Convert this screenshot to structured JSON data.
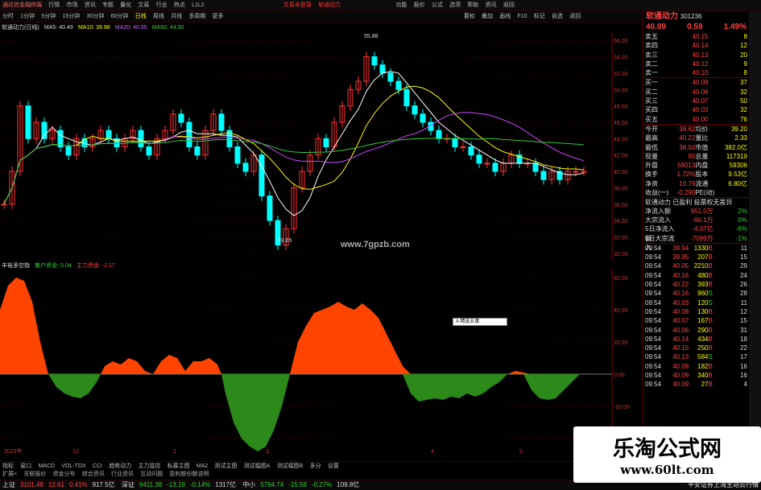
{
  "titlebar": {
    "app": "通达信金融终端",
    "menus": [
      "行情",
      "市场",
      "资讯",
      "专题",
      "量化",
      "文易",
      "行业",
      "热点",
      "L1L2"
    ],
    "mode": "文易未登录",
    "stock_mode": "软通动力",
    "right": [
      "功能",
      "报价",
      "公式",
      "选项",
      "帮助",
      "资讯",
      "返回"
    ]
  },
  "periodbar": {
    "items": [
      "分时",
      "1分钟",
      "5分钟",
      "15分钟",
      "30分钟",
      "60分钟",
      "日线",
      "周线",
      "月线",
      "多周期",
      "更多"
    ],
    "active": "日线",
    "right": [
      "置权",
      "叠加",
      "画线",
      "F10",
      "标记",
      "自选",
      "返回"
    ]
  },
  "kinfo": {
    "name": "软通动力(日线)",
    "ma5": "MA5: 40.49",
    "ma10": "MA10: 39.98",
    "ma20": "MA20: 40.95",
    "ma60": "MA60: 44.90"
  },
  "chart_labels": {
    "high": "55.88",
    "low": "28.65",
    "watermark": "www.7gpzb.com"
  },
  "subinfo": {
    "name": "丰裕多空指",
    "dark": "散户资金: 0.04",
    "red": "主力资金: -2.17"
  },
  "tooltip": "A 精选五度 ",
  "tabs": [
    "指标",
    "窗口",
    "MACD",
    "VOL-TDX",
    "CCI",
    "趋势动力",
    "主力监控",
    "私募主图",
    "MA2",
    "测试主图",
    "测试幅图A",
    "测试幅图B",
    "多分",
    "设置"
  ],
  "secbar": [
    "扩展<",
    "关联报价",
    "资金分布",
    "综合资讯",
    "行业资讯",
    "互动问题",
    "盈利额份额说明"
  ],
  "status": [
    {
      "label": "上证",
      "value": "3101.48",
      "chg": "12.61",
      "pct": "0.41%",
      "amt": "917.5亿"
    },
    {
      "label": "深证",
      "value": "9411.38",
      "chg": "-13.19",
      "pct": "-0.14%",
      "amt": "1317亿"
    },
    {
      "label": "中小",
      "value": "5794.74",
      "chg": "-15.58",
      "pct": "-0.27%",
      "amt": "109.8亿"
    }
  ],
  "status_right": "平安证券上海主站云行情",
  "quote": {
    "name": "软通动力",
    "code": "301236",
    "price": "40.09",
    "chg": "0.59",
    "pct": "1.49%",
    "asks": [
      [
        "卖五",
        "40.15",
        "8"
      ],
      [
        "卖四",
        "40.14",
        "12"
      ],
      [
        "卖三",
        "40.13",
        "20"
      ],
      [
        "卖二",
        "40.12",
        "9"
      ],
      [
        "卖一",
        "40.10",
        "8"
      ]
    ],
    "bids": [
      [
        "买一",
        "40.09",
        "37"
      ],
      [
        "买二",
        "40.08",
        "32"
      ],
      [
        "买三",
        "40.07",
        "50"
      ],
      [
        "买四",
        "40.03",
        "32"
      ],
      [
        "买五",
        "40.00",
        "76"
      ]
    ],
    "stats": [
      [
        "今开",
        "39.62",
        "均价",
        "39.20"
      ],
      [
        "最高",
        "40.22",
        "量比",
        "2.33"
      ],
      [
        "最低",
        "38.50",
        "市值",
        "382.0亿"
      ],
      [
        "现量",
        "90",
        "总量",
        "117319"
      ],
      [
        "外盘",
        "58013",
        "内盘",
        "59306"
      ],
      [
        "换手",
        "1.72%",
        "股本",
        "9.53亿"
      ],
      [
        "净资",
        "10.79",
        "流通",
        "6.80亿"
      ],
      [
        "收益(一)",
        "-0.290",
        "PE(动)",
        ""
      ]
    ],
    "flow_title": "软通动力 已盈利 投票权无差异",
    "flows": [
      [
        "净流入额",
        "951.0万",
        "2%"
      ],
      [
        "大宗流入",
        "-60.1万",
        "0%"
      ],
      [
        "5日净流入额",
        "-4.07亿",
        "-6%"
      ],
      [
        "5日大宗流入",
        "-7099万",
        "-1%"
      ]
    ],
    "ticks": [
      [
        "09:54",
        "39.94",
        "1330",
        "B",
        "11"
      ],
      [
        "09:54",
        "39.95",
        "207",
        "B",
        "15"
      ],
      [
        "09:54",
        "40.05",
        "2210",
        "B",
        "29"
      ],
      [
        "09:54",
        "40.16",
        "480",
        "B",
        "24"
      ],
      [
        "09:54",
        "40.22",
        "393",
        "B",
        "26"
      ],
      [
        "09:54",
        "40.16",
        "960",
        "S",
        "28"
      ],
      [
        "09:54",
        "40.03",
        "120",
        "S",
        "11"
      ],
      [
        "09:54",
        "40.08",
        "130",
        "B",
        "12"
      ],
      [
        "09:54",
        "40.07",
        "167",
        "B",
        "15"
      ],
      [
        "09:54",
        "40.06",
        "290",
        "B",
        "31"
      ],
      [
        "09:54",
        "40.14",
        "434",
        "B",
        "18"
      ],
      [
        "09:54",
        "40.15",
        "250",
        "B",
        "22"
      ],
      [
        "09:54",
        "40.13",
        "584",
        "S",
        "17"
      ],
      [
        "09:54",
        "40.09",
        "182",
        "B",
        "16"
      ],
      [
        "09:54",
        "40.09",
        "340",
        "B",
        "16"
      ],
      [
        "09:54",
        "40.09",
        "27",
        "B",
        "4"
      ]
    ]
  },
  "axis_main": [
    "56.00",
    "54.00",
    "52.00",
    "50.00",
    "48.00",
    "46.00",
    "44.00",
    "42.00",
    "40.00",
    "38.00",
    "36.00",
    "34.00",
    "32.00",
    "30.00"
  ],
  "axis_sub": [
    "60.00",
    "40.00",
    "20.00",
    "0.00",
    "-20.00",
    "-40.00"
  ],
  "xlabels": [
    "2023年",
    "12",
    "2",
    "3",
    "4",
    "5"
  ],
  "logo": {
    "line1": "乐淘公式网",
    "line2": "www.60lt.com"
  },
  "colors": {
    "up": "#ff3333",
    "down": "#00ffff",
    "ma5": "#ffffff",
    "ma10": "#ffff00",
    "ma20": "#cc44ff",
    "ma60": "#33cc33",
    "pos": "#ff4400",
    "neg": "#2d8a1a"
  }
}
